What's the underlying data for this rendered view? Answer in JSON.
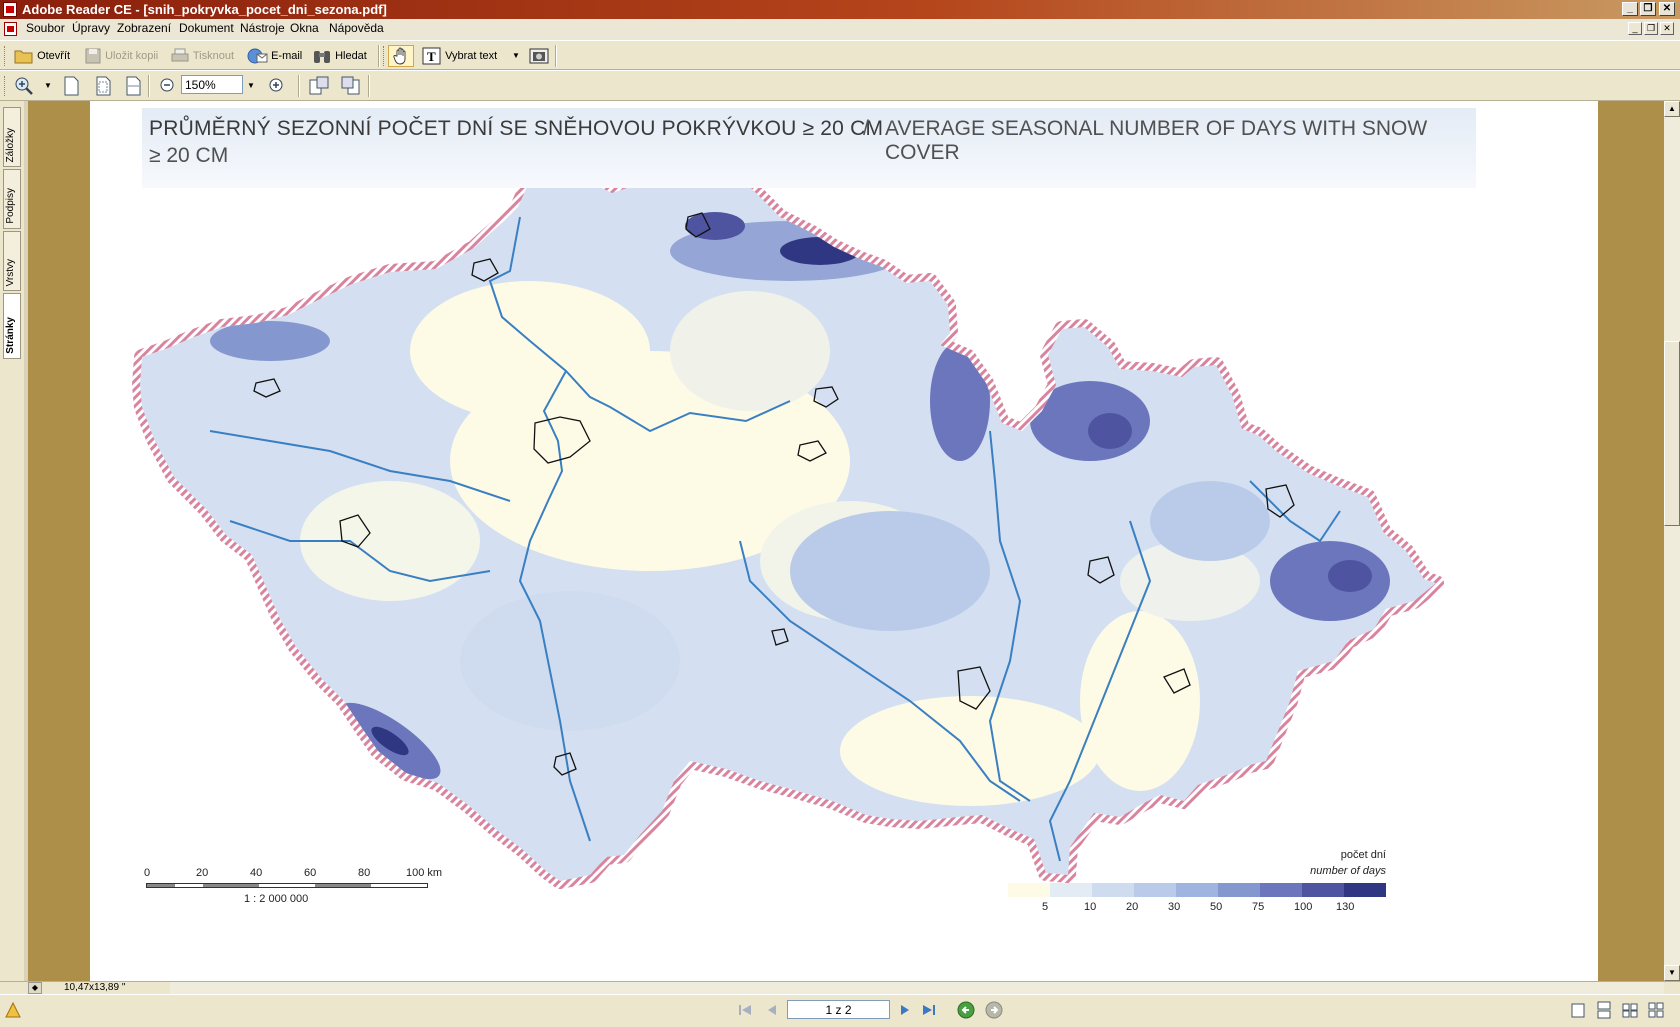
{
  "window": {
    "title": "Adobe Reader CE - [snih_pokryvka_pocet_dni_sezona.pdf]"
  },
  "menu": [
    "Soubor",
    "Úpravy",
    "Zobrazení",
    "Dokument",
    "Nástroje",
    "Okna",
    "Nápověda"
  ],
  "toolbar": {
    "open": "Otevřít",
    "save_copy": "Uložit kopii",
    "print": "Tisknout",
    "email": "E-mail",
    "search": "Hledat",
    "select_text": "Vybrat text",
    "zoom": "150%"
  },
  "side_tabs": [
    "Záložky",
    "Podpisy",
    "Vrstvy",
    "Stránky"
  ],
  "map": {
    "title_cz": "PRŮMĚRNÝ SEZONNÍ POČET DNÍ SE SNĚHOVOU POKRÝVKOU ≥ 20 CM",
    "title_separator": "/",
    "title_en_line1": "AVERAGE SEASONAL NUMBER OF DAYS WITH SNOW COVER",
    "title_en_line2": "≥ 20 CM",
    "scale_ticks": [
      "0",
      "20",
      "40",
      "60",
      "80",
      "100 km"
    ],
    "scale_ratio": "1 : 2 000 000",
    "legend_title_cz": "počet dní",
    "legend_title_en": "number of days",
    "legend_values": [
      "5",
      "10",
      "20",
      "30",
      "50",
      "75",
      "100",
      "130"
    ],
    "legend_colors": [
      "#fdfbe6",
      "#e3ebf5",
      "#cfdcef",
      "#b9cbe9",
      "#9fb4de",
      "#8597cf",
      "#6c76bd",
      "#4f54a1",
      "#2f3783"
    ]
  },
  "status": {
    "page_size": "10,47x13,89 \""
  },
  "navigation": {
    "page_indicator": "1 z 2"
  }
}
